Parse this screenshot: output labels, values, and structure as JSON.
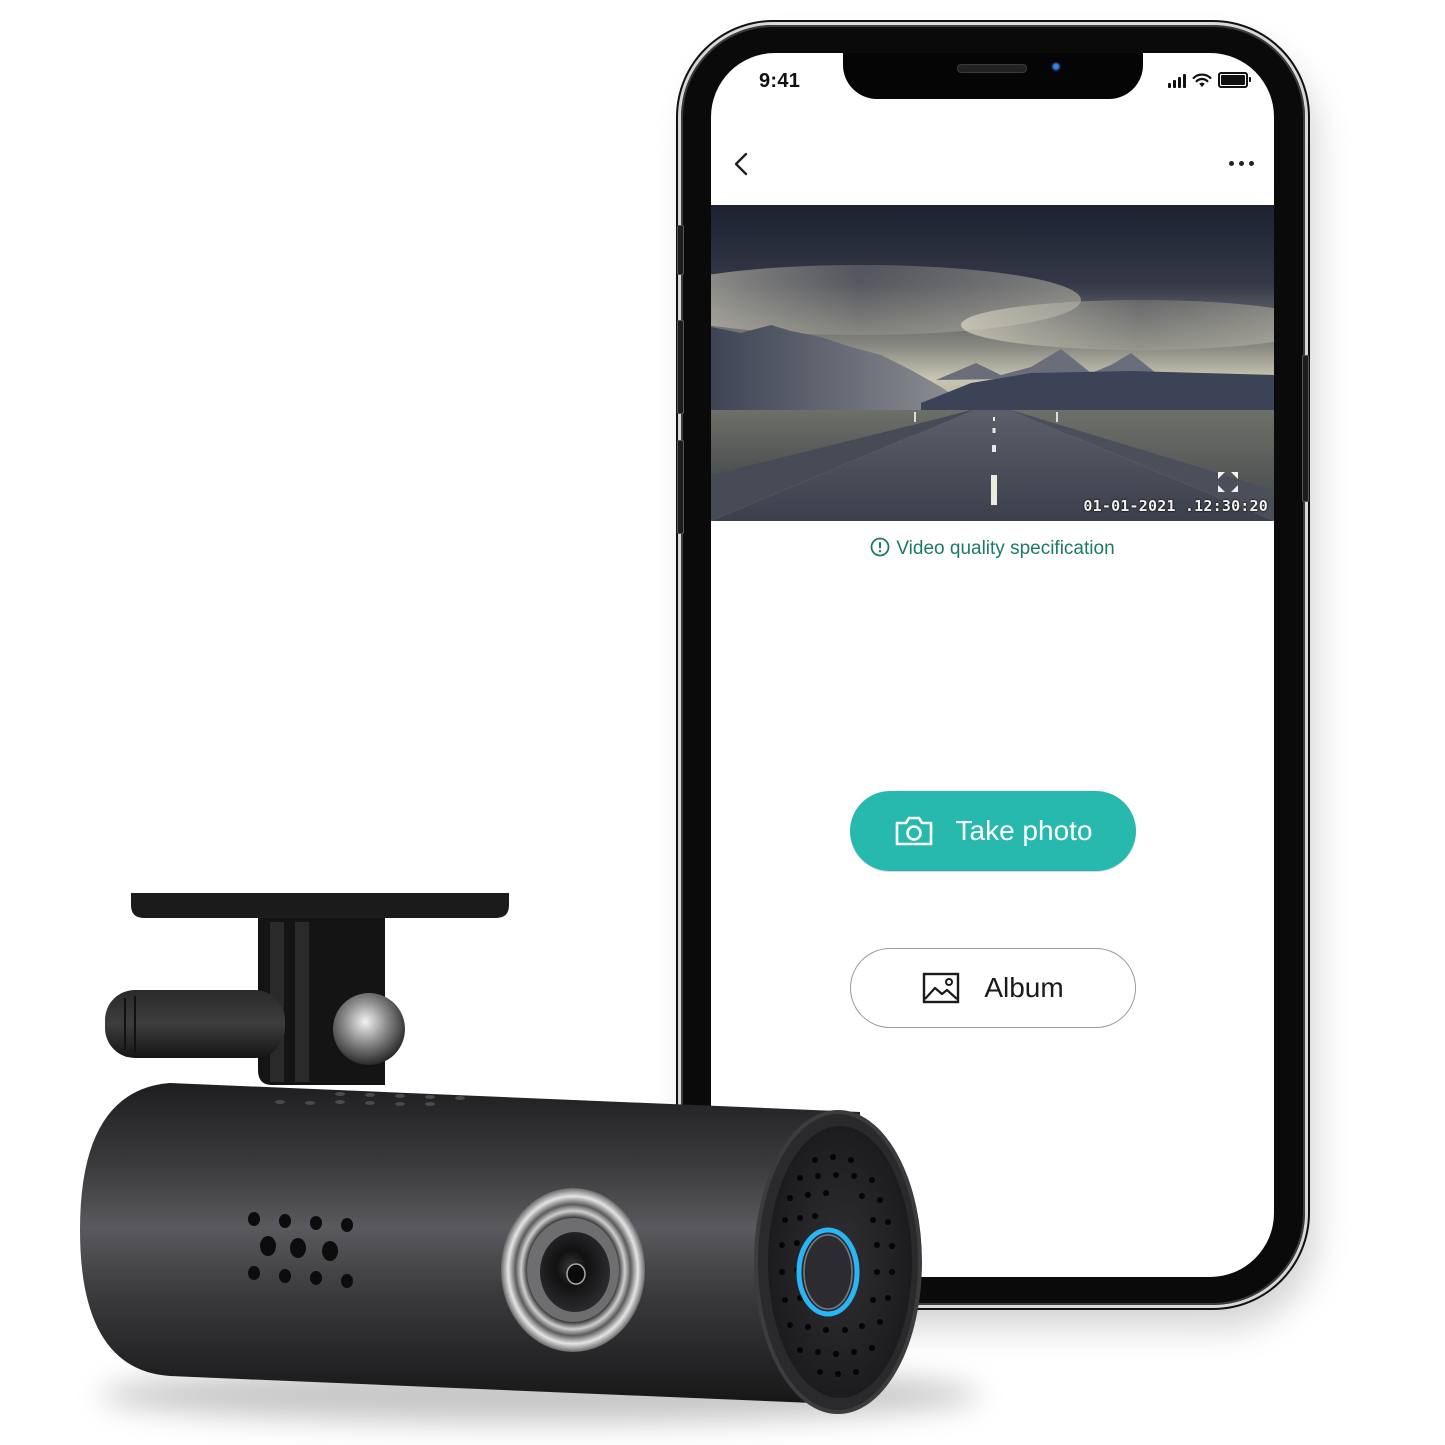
{
  "phone": {
    "status_bar": {
      "time": "9:41",
      "icons": [
        "cellular-signal-icon",
        "wifi-icon",
        "battery-icon"
      ]
    },
    "nav": {
      "back_icon": "chevron-left-icon",
      "more_icon": "more-horizontal-icon"
    },
    "video_preview": {
      "timestamp": "01-01-2021 .12:30:20",
      "fullscreen_icon": "expand-icon"
    },
    "spec_link": {
      "icon": "info-circle-icon",
      "label": "Video quality specification"
    },
    "take_photo": {
      "icon": "camera-icon",
      "label": "Take photo"
    },
    "album": {
      "icon": "image-icon",
      "label": "Album"
    },
    "colors": {
      "accent": "#27b9ad",
      "link": "#1b7a67",
      "text": "#1a1a1a"
    }
  },
  "product": {
    "name_icon": "dash-cam",
    "indicator_color": "#29b6f6"
  }
}
